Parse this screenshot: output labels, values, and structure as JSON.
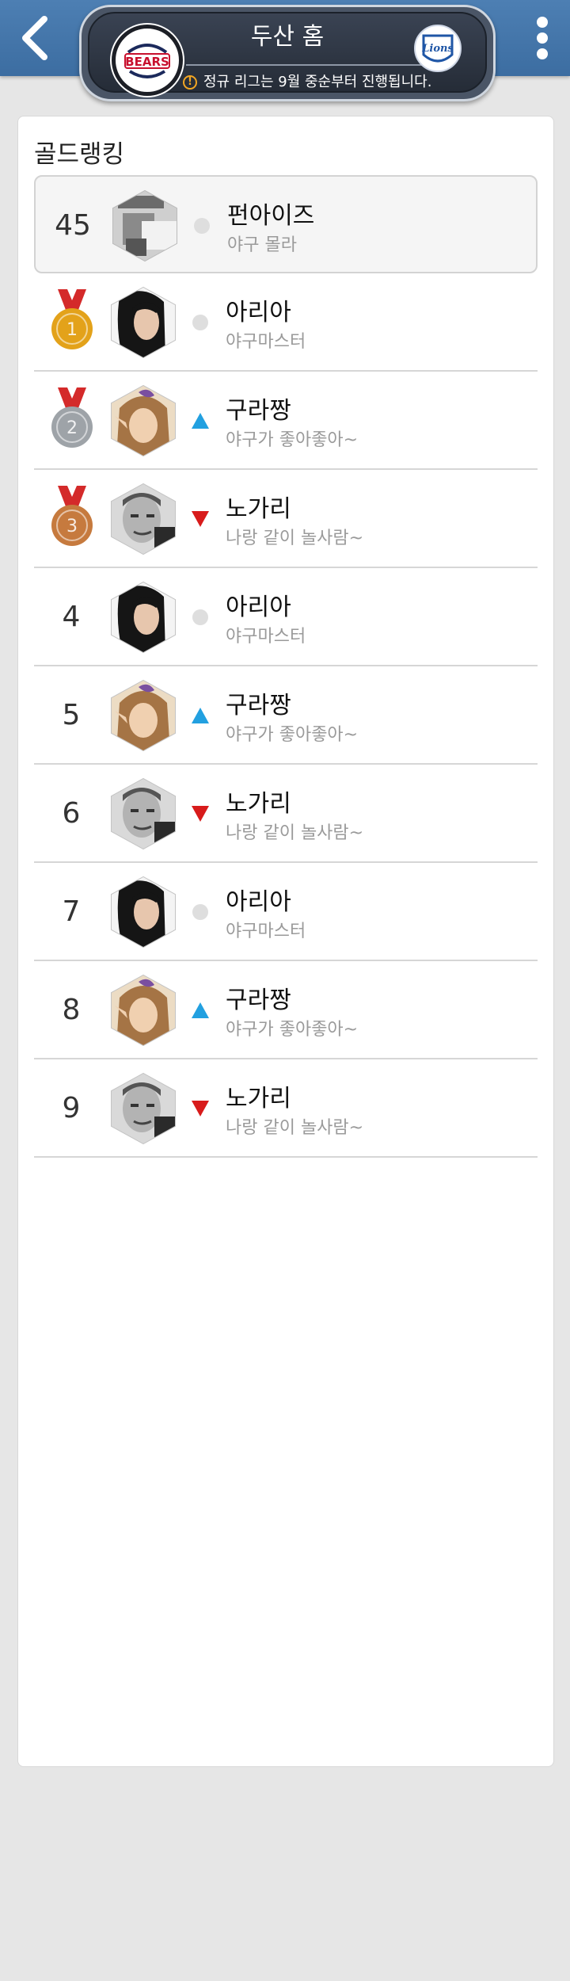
{
  "header": {
    "title": "두산 홈",
    "notice": "정규 리그는 9월 중순부터 진행됩니다.",
    "home_logo_text": "BEARS",
    "away_logo_text": "Lions",
    "colors": {
      "topbar": "#3f70a4",
      "notice_icon": "#f2a623",
      "home_logo_red": "#c8102e",
      "away_logo_blue": "#1f56a6"
    }
  },
  "ranking": {
    "title": "골드랭킹",
    "my_rank": {
      "rank": "45",
      "nickname": "펀아이즈",
      "motto": "야구 몰라",
      "trend": "same",
      "avatar_icon": "user-avatar-icon"
    },
    "rows": [
      {
        "rank": "1",
        "medal": "gold",
        "nickname": "아리아",
        "motto": "야구마스터",
        "trend": "same",
        "avatar_icon": "woman-avatar-icon"
      },
      {
        "rank": "2",
        "medal": "silver",
        "nickname": "구라짱",
        "motto": "야구가 좋아좋아~",
        "trend": "up",
        "avatar_icon": "elf-avatar-icon"
      },
      {
        "rank": "3",
        "medal": "bronze",
        "nickname": "노가리",
        "motto": "나랑 같이 놀사람~",
        "trend": "down",
        "avatar_icon": "man-avatar-icon"
      },
      {
        "rank": "4",
        "medal": "",
        "nickname": "아리아",
        "motto": "야구마스터",
        "trend": "same",
        "avatar_icon": "woman-avatar-icon"
      },
      {
        "rank": "5",
        "medal": "",
        "nickname": "구라짱",
        "motto": "야구가 좋아좋아~",
        "trend": "up",
        "avatar_icon": "elf-avatar-icon"
      },
      {
        "rank": "6",
        "medal": "",
        "nickname": "노가리",
        "motto": "나랑 같이 놀사람~",
        "trend": "down",
        "avatar_icon": "man-avatar-icon"
      },
      {
        "rank": "7",
        "medal": "",
        "nickname": "아리아",
        "motto": "야구마스터",
        "trend": "same",
        "avatar_icon": "woman-avatar-icon"
      },
      {
        "rank": "8",
        "medal": "",
        "nickname": "구라짱",
        "motto": "야구가 좋아좋아~",
        "trend": "up",
        "avatar_icon": "elf-avatar-icon"
      },
      {
        "rank": "9",
        "medal": "",
        "nickname": "노가리",
        "motto": "나랑 같이 놀사람~",
        "trend": "down",
        "avatar_icon": "man-avatar-icon"
      }
    ],
    "trend_colors": {
      "up": "#22a0e0",
      "down": "#d81b1b",
      "same": "#dedede"
    },
    "medal_colors": {
      "gold": "#e3a21a",
      "silver": "#9ea3a8",
      "bronze": "#c67a3e",
      "ribbon": "#d42a2a"
    }
  }
}
